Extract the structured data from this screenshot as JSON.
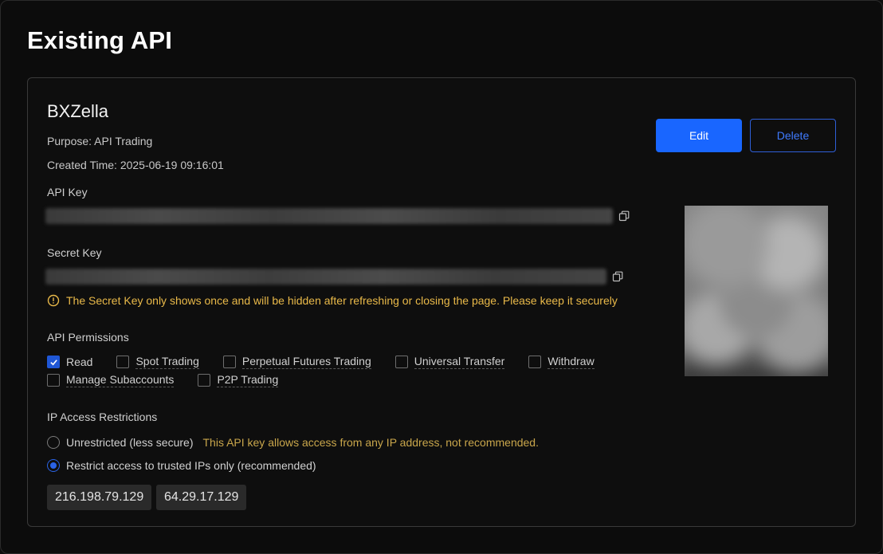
{
  "page": {
    "title": "Existing API"
  },
  "api": {
    "name": "BXZella",
    "purpose": "Purpose: API Trading",
    "created": "Created Time: 2025-06-19 09:16:01",
    "api_key_label": "API Key",
    "secret_key_label": "Secret Key",
    "warning": "The Secret Key only shows once and will be hidden after refreshing or closing the page. Please keep it securely"
  },
  "actions": {
    "edit_label": "Edit",
    "delete_label": "Delete"
  },
  "permissions": {
    "label": "API Permissions",
    "items": [
      {
        "label": "Read",
        "checked": true
      },
      {
        "label": "Spot Trading",
        "checked": false
      },
      {
        "label": "Perpetual Futures Trading",
        "checked": false
      },
      {
        "label": "Universal Transfer",
        "checked": false
      },
      {
        "label": "Withdraw",
        "checked": false
      },
      {
        "label": "Manage Subaccounts",
        "checked": false
      },
      {
        "label": "P2P Trading",
        "checked": false
      }
    ]
  },
  "ip": {
    "label": "IP Access Restrictions",
    "option_unrestricted": "Unrestricted (less secure)",
    "option_unrestricted_note": "This API key allows access from any IP address, not recommended.",
    "option_restricted": "Restrict access to trusted IPs only (recommended)",
    "selected": "restricted",
    "addresses": [
      "216.198.79.129",
      "64.29.17.129"
    ]
  },
  "colors": {
    "accent": "#1966ff",
    "warning": "#e9b949",
    "note": "#c9a64b"
  },
  "icons": {
    "copy": "copy-icon",
    "warning": "warning-circle-icon",
    "check": "check-icon"
  }
}
